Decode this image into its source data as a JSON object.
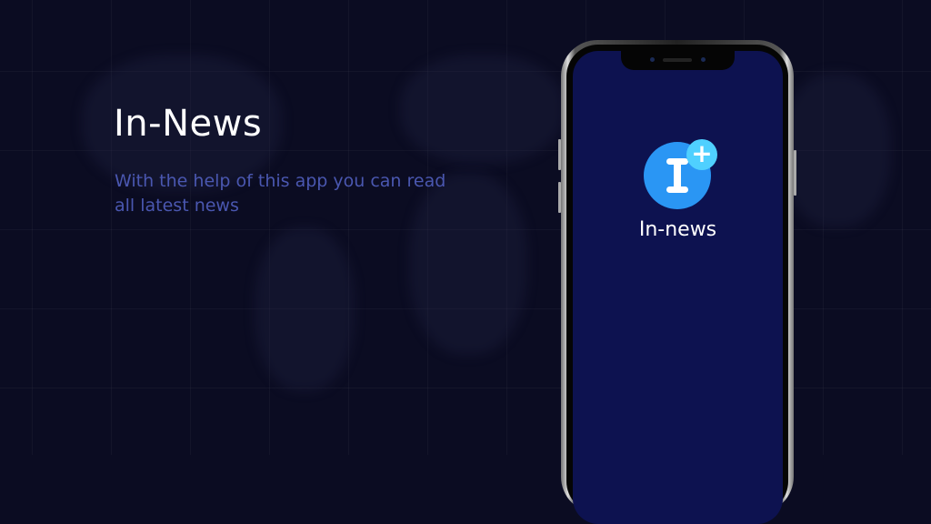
{
  "headline": "In-News",
  "description": "With the help of this app you can read all latest news",
  "phone": {
    "app_name": "In-news",
    "app_icon_letter": "I",
    "badge_symbol": "+",
    "icon_color": "#2a96f4",
    "badge_color": "#4fd0ff",
    "screen_color": "#0d1250"
  },
  "background_color": "#0b0c22",
  "accent_text_color": "#4a57b0"
}
